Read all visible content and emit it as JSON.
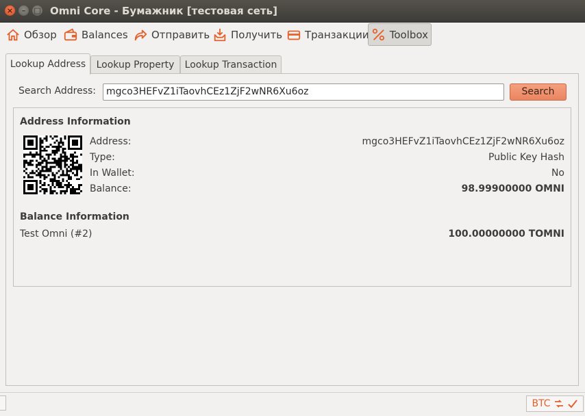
{
  "window": {
    "title": "Omni Core - Бумажник [тестовая сеть]"
  },
  "toolbar": {
    "items": [
      {
        "label": "Обзор",
        "icon": "home-icon"
      },
      {
        "label": "Balances",
        "icon": "wallet-icon"
      },
      {
        "label": "Отправить",
        "icon": "send-icon"
      },
      {
        "label": "Получить",
        "icon": "receive-icon"
      },
      {
        "label": "Транзакции",
        "icon": "transactions-icon"
      },
      {
        "label": "Toolbox",
        "icon": "tools-icon",
        "active": true
      }
    ]
  },
  "tabs": [
    {
      "label": "Lookup Address",
      "active": true
    },
    {
      "label": "Lookup Property"
    },
    {
      "label": "Lookup Transaction"
    }
  ],
  "search": {
    "label": "Search Address:",
    "value": "mgco3HEFvZ1iTaovhCEz1ZjF2wNR6Xu6oz",
    "button": "Search"
  },
  "address_info": {
    "title": "Address Information",
    "rows": [
      {
        "label": "Address:",
        "value": "mgco3HEFvZ1iTaovhCEz1ZjF2wNR6Xu6oz"
      },
      {
        "label": "Type:",
        "value": "Public Key Hash"
      },
      {
        "label": "In Wallet:",
        "value": "No"
      },
      {
        "label": "Balance:",
        "value": "98.99900000 OMNI"
      }
    ]
  },
  "balance_info": {
    "title": "Balance Information",
    "rows": [
      {
        "label": "Test Omni (#2)",
        "value": "100.00000000 TOMNI"
      }
    ]
  },
  "statusbar": {
    "unit": "BTC"
  },
  "colors": {
    "accent": "#e2622d",
    "search_button": "#f09070",
    "titlebar": "#3e3c38"
  }
}
